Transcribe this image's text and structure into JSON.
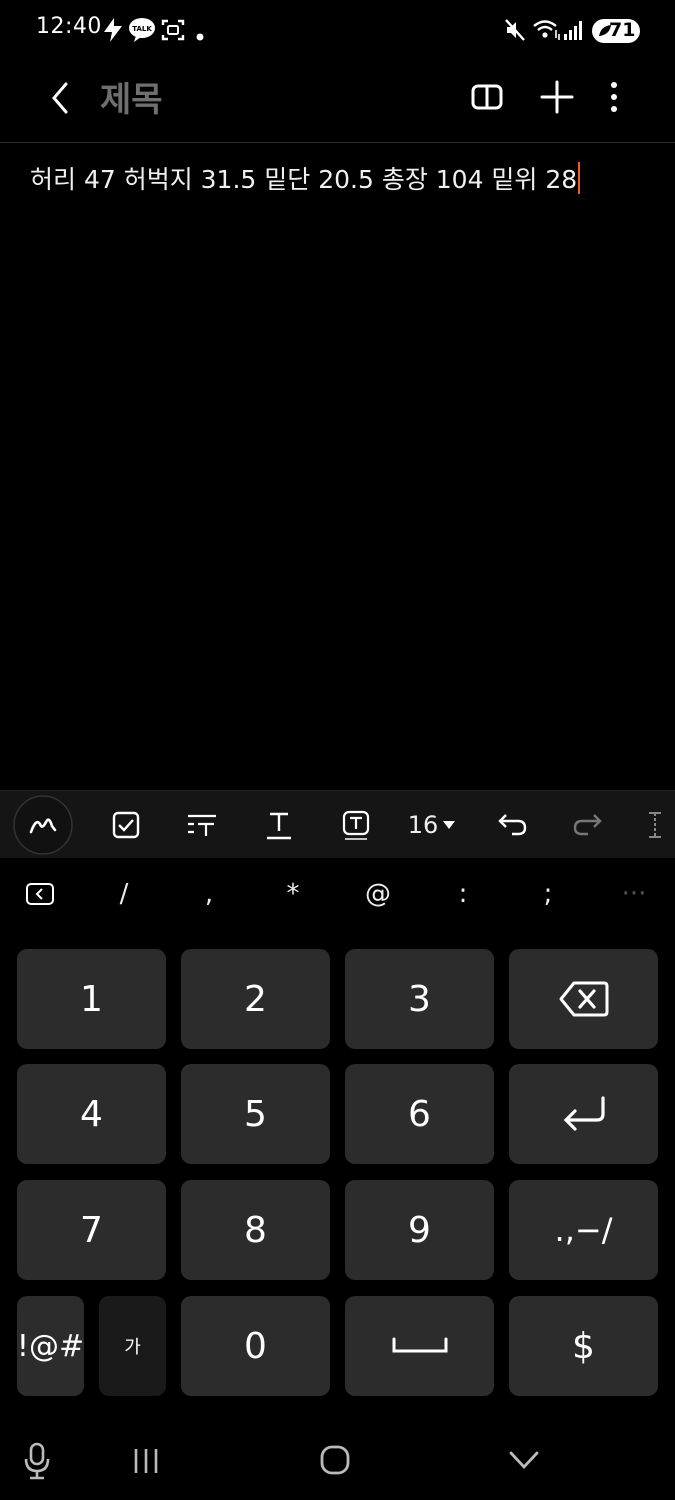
{
  "status_bar": {
    "time": "12:40",
    "left_icons": [
      "flash-icon",
      "kakaotalk-icon",
      "screenshot-icon",
      "dot-icon"
    ],
    "kakaotalk_badge": "TALK",
    "battery": "71",
    "right_icons": [
      "mute-icon",
      "wifi-icon",
      "signal-icon",
      "battery-icon"
    ]
  },
  "header": {
    "back_icon": "chevron-left-icon",
    "title": "제목",
    "actions": [
      "book-icon",
      "plus-icon",
      "more-vertical-icon"
    ]
  },
  "note": {
    "content": "허리 47 허벅지 31.5 밑단 20.5 총장 104 밑위 28"
  },
  "toolbar": {
    "items": [
      "handwriting-icon",
      "checkbox-icon",
      "text-style-icon",
      "underline-text-icon",
      "text-box-icon",
      "font-size",
      "undo-icon",
      "redo-icon",
      "more-icon"
    ],
    "font_size": "16"
  },
  "symbol_row": {
    "keys": [
      "/",
      ",",
      "*",
      "@",
      ":",
      ";"
    ],
    "more": "···"
  },
  "keyboard": {
    "rows": [
      [
        "1",
        "2",
        "3"
      ],
      [
        "4",
        "5",
        "6"
      ],
      [
        "7",
        "8",
        "9"
      ]
    ],
    "punct_key": ".,−/",
    "symbols_key": "!@#",
    "korean_key": "가",
    "zero_key": "0",
    "currency_key": "$"
  },
  "navbar": {
    "items": [
      "mic-icon",
      "recents-icon",
      "home-icon",
      "hide-keyboard-icon"
    ]
  }
}
